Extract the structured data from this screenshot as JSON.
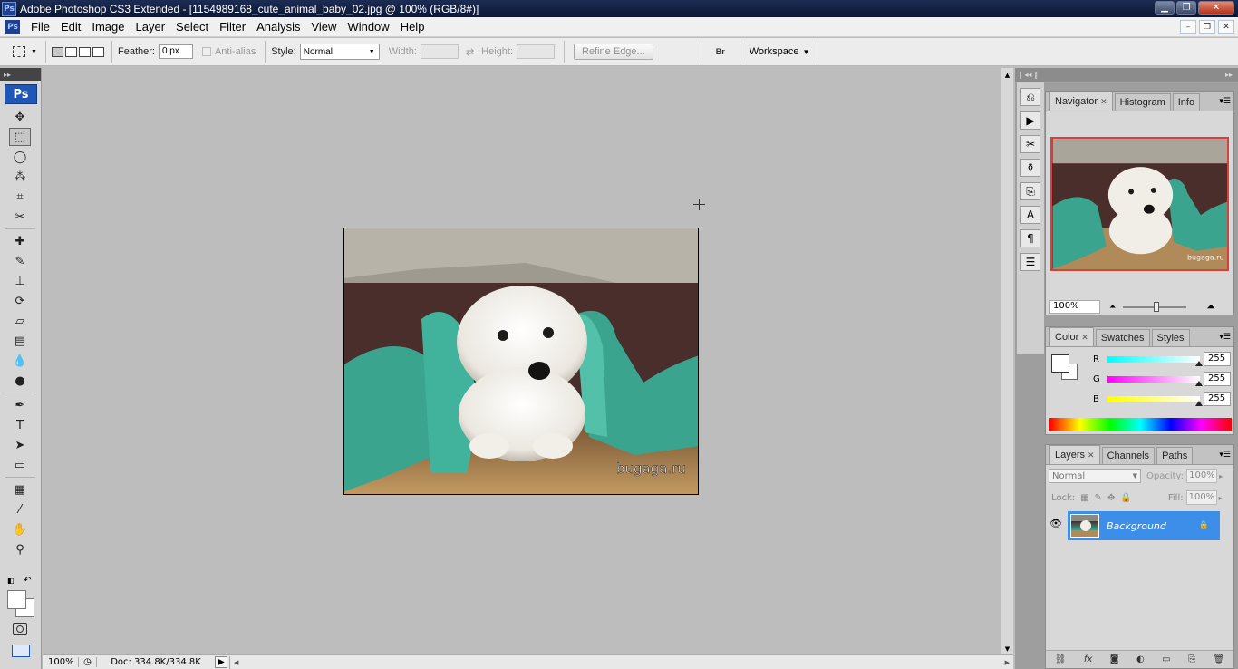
{
  "window": {
    "title": "Adobe Photoshop CS3 Extended - [1154989168_cute_animal_baby_02.jpg @ 100% (RGB/8#)]",
    "app_icon": "Ps",
    "buttons": {
      "minimize": "▁",
      "restore": "❐",
      "close": "✕"
    }
  },
  "menu": {
    "items": [
      "File",
      "Edit",
      "Image",
      "Layer",
      "Select",
      "Filter",
      "Analysis",
      "View",
      "Window",
      "Help"
    ],
    "mdi": {
      "minimize": "–",
      "restore": "❐",
      "close": "✕"
    }
  },
  "options": {
    "feather_label": "Feather:",
    "feather_value": "0 px",
    "antialias_label": "Anti-alias",
    "style_label": "Style:",
    "style_value": "Normal",
    "width_label": "Width:",
    "height_label": "Height:",
    "refine_edge": "Refine Edge...",
    "workspace": "Workspace"
  },
  "toolbox": {
    "logo": "Ps",
    "tools": [
      {
        "name": "move-tool",
        "glyph": "✥"
      },
      {
        "name": "marquee-tool",
        "glyph": "⬚",
        "active": true
      },
      {
        "name": "lasso-tool",
        "glyph": "◯"
      },
      {
        "name": "magic-wand-tool",
        "glyph": "⁂"
      },
      {
        "name": "crop-tool",
        "glyph": "⌗"
      },
      {
        "name": "slice-tool",
        "glyph": "✂"
      },
      {
        "name": "healing-brush-tool",
        "glyph": "✚"
      },
      {
        "name": "brush-tool",
        "glyph": "✎"
      },
      {
        "name": "clone-stamp-tool",
        "glyph": "⊥"
      },
      {
        "name": "history-brush-tool",
        "glyph": "⟳"
      },
      {
        "name": "eraser-tool",
        "glyph": "▱"
      },
      {
        "name": "gradient-tool",
        "glyph": "▤"
      },
      {
        "name": "blur-tool",
        "glyph": "💧"
      },
      {
        "name": "dodge-tool",
        "glyph": "●"
      },
      {
        "name": "pen-tool",
        "glyph": "✒"
      },
      {
        "name": "type-tool",
        "glyph": "T"
      },
      {
        "name": "path-selection-tool",
        "glyph": "➤"
      },
      {
        "name": "shape-tool",
        "glyph": "▭"
      },
      {
        "name": "notes-tool",
        "glyph": "▦"
      },
      {
        "name": "eyedropper-tool",
        "glyph": "⁄"
      },
      {
        "name": "hand-tool",
        "glyph": "✋"
      },
      {
        "name": "zoom-tool",
        "glyph": "⚲"
      }
    ]
  },
  "document": {
    "watermark": "bugaga.ru"
  },
  "status": {
    "zoom": "100%",
    "doc": "Doc: 334.8K/334.8K"
  },
  "navigator": {
    "tabs": [
      "Navigator",
      "Histogram",
      "Info"
    ],
    "zoom": "100%",
    "watermark": "bugaga.ru"
  },
  "color": {
    "tabs": [
      "Color",
      "Swatches",
      "Styles"
    ],
    "channels": [
      {
        "label": "R",
        "value": "255",
        "gradient": "linear-gradient(90deg,#00ffff,#ffffff)"
      },
      {
        "label": "G",
        "value": "255",
        "gradient": "linear-gradient(90deg,#ff00ff,#ffffff)"
      },
      {
        "label": "B",
        "value": "255",
        "gradient": "linear-gradient(90deg,#ffff00,#ffffff)"
      }
    ]
  },
  "layers": {
    "tabs": [
      "Layers",
      "Channels",
      "Paths"
    ],
    "blend_mode": "Normal",
    "opacity_label": "Opacity:",
    "opacity": "100%",
    "lock_label": "Lock:",
    "fill_label": "Fill:",
    "fill": "100%",
    "layer_name": "Background",
    "selected_color": "#3c8ee8"
  }
}
